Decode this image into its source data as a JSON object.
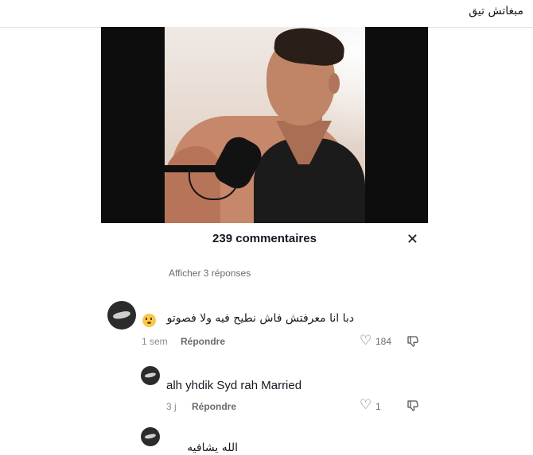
{
  "post": {
    "title": "مبغاتش تيق"
  },
  "comments_panel": {
    "count_label": "239 commentaires",
    "view_replies": "Afficher 3 réponses",
    "comments": [
      {
        "text": "دبا انا معرفتش فاش نطيح فيه ولا فصوتو",
        "emoji": "flushed-face",
        "time": "1 sem",
        "reply_label": "Répondre",
        "likes": "184"
      },
      {
        "text": "alh yhdik Syd rah Married",
        "time": "3 j",
        "reply_label": "Répondre",
        "likes": "1"
      },
      {
        "text": "الله يشافيه"
      }
    ]
  },
  "icons": {
    "close": "close-icon",
    "like": "heart-icon",
    "dislike": "thumbs-down-icon"
  }
}
